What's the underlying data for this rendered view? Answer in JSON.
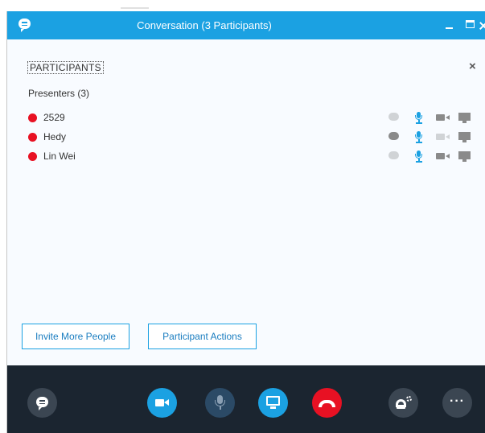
{
  "window": {
    "title": "Conversation (3 Participants)"
  },
  "panel": {
    "title": "PARTICIPANTS",
    "close_glyph": "×"
  },
  "group": {
    "label": "Presenters (3)"
  },
  "participants": [
    {
      "name": "2529",
      "status_color": "#e81123",
      "im_active": false,
      "video_active": true
    },
    {
      "name": "Hedy",
      "status_color": "#e81123",
      "im_active": true,
      "video_active": false
    },
    {
      "name": "Lin Wei",
      "status_color": "#e81123",
      "im_active": false,
      "video_active": true
    }
  ],
  "actions": {
    "invite": "Invite More People",
    "participant_actions": "Participant Actions"
  },
  "controls": {
    "more_label": "···"
  },
  "colors": {
    "accent": "#1ba1e2",
    "bar": "#1b2530",
    "hangup": "#e81123",
    "presence_busy": "#e81123"
  }
}
